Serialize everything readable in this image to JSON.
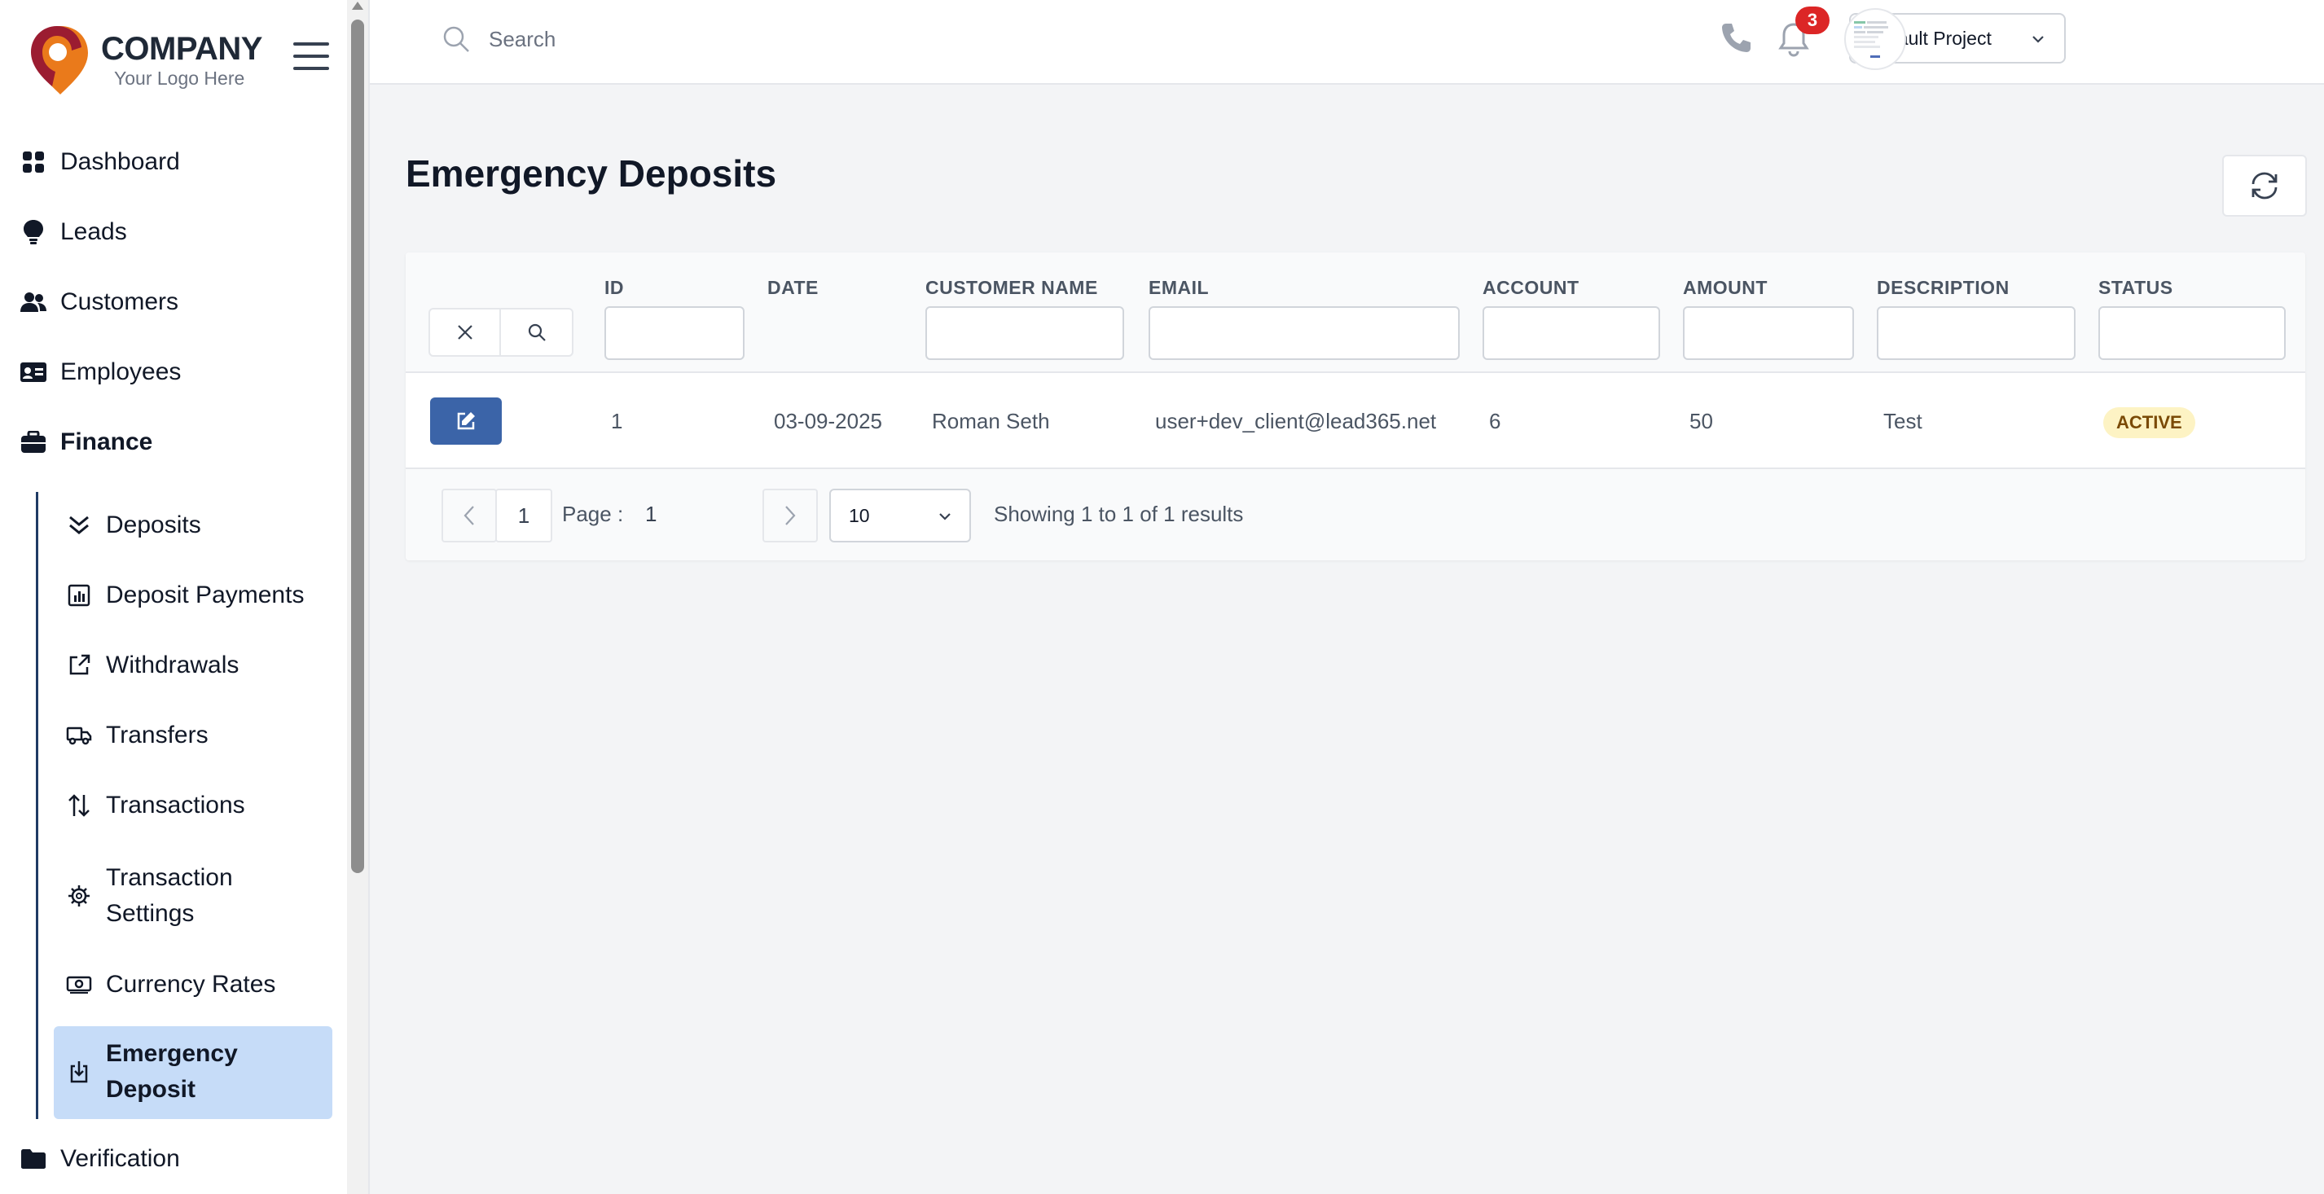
{
  "brand": {
    "name": "COMPANY",
    "tagline": "Your Logo Here",
    "colors": {
      "primary": "#9b1c31",
      "accent": "#ea7a1b"
    }
  },
  "sidebar": {
    "items": [
      {
        "label": "Dashboard",
        "icon": "dashboard-grid-icon"
      },
      {
        "label": "Leads",
        "icon": "lightbulb-icon"
      },
      {
        "label": "Customers",
        "icon": "users-icon"
      },
      {
        "label": "Employees",
        "icon": "id-card-icon"
      },
      {
        "label": "Finance",
        "icon": "briefcase-icon",
        "expanded": true
      },
      {
        "label": "Verification",
        "icon": "folder-icon"
      }
    ],
    "finance_sub": [
      {
        "label": "Deposits",
        "icon": "double-chevron-down-icon"
      },
      {
        "label": "Deposit Payments",
        "icon": "bar-chart-icon"
      },
      {
        "label": "Withdrawals",
        "icon": "external-link-icon"
      },
      {
        "label": "Transfers",
        "icon": "truck-icon"
      },
      {
        "label": "Transactions",
        "icon": "arrows-up-down-icon"
      },
      {
        "label_line1": "Transaction",
        "label_line2": "Settings",
        "icon": "gear-icon"
      },
      {
        "label": "Currency Rates",
        "icon": "banknote-icon"
      },
      {
        "label_line1": "Emergency",
        "label_line2": "Deposit",
        "icon": "download-icon",
        "active": true
      }
    ],
    "active_color": "#c6dcf8"
  },
  "topbar": {
    "search_placeholder": "Search",
    "project": "Default Project",
    "notifications_count": "3"
  },
  "page": {
    "title": "Emergency Deposits"
  },
  "table": {
    "columns": [
      "ID",
      "DATE",
      "CUSTOMER NAME",
      "EMAIL",
      "ACCOUNT",
      "AMOUNT",
      "DESCRIPTION",
      "STATUS"
    ],
    "rows": [
      {
        "id": "1",
        "date": "03-09-2025",
        "customer_name": "Roman Seth",
        "email": "user+dev_client@lead365.net",
        "account": "6",
        "amount": "50",
        "description": "Test",
        "status": "ACTIVE"
      }
    ],
    "status_colors": {
      "active_bg": "#fdf3c4",
      "active_text": "#7a4a06"
    },
    "edit_button_color": "#3b64a8"
  },
  "pagination": {
    "page_input": "1",
    "page_label": "Page :",
    "current_page": "1",
    "page_size": "10",
    "results_text": "Showing 1 to 1 of 1 results"
  }
}
